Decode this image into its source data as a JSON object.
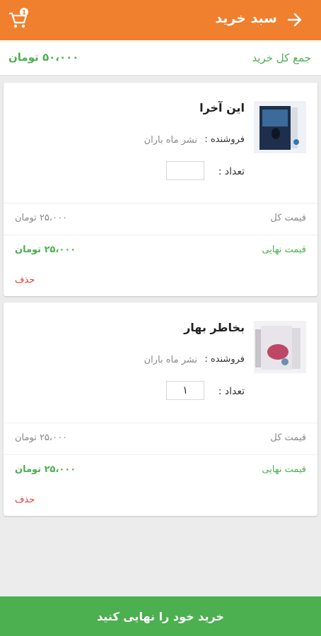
{
  "header": {
    "title": "سبد خرید",
    "back_icon": "arrow-right-icon",
    "cart_icon": "cart-icon",
    "cart_badge": "1",
    "bg_color": "#f07f2e"
  },
  "summary": {
    "label": "جمع کل خرید",
    "value": "۵۰،۰۰۰ تومان"
  },
  "items": [
    {
      "title": "این آخرا",
      "seller_label": "فروشنده :",
      "seller": "نشر ماه باران",
      "qty_label": "تعداد :",
      "qty": "",
      "total_label": "قیمت کل",
      "total": "۲۵،۰۰۰ تومان",
      "final_label": "قیمت نهایی",
      "final": "۲۵،۰۰۰ تومان",
      "delete_label": "حذف"
    },
    {
      "title": "بخاطر بهار",
      "seller_label": "فروشنده :",
      "seller": "نشر ماه باران",
      "qty_label": "تعداد :",
      "qty": "۱",
      "total_label": "قیمت کل",
      "total": "۲۵،۰۰۰ تومان",
      "final_label": "قیمت نهایی",
      "final": "۲۵،۰۰۰ تومان",
      "delete_label": "حذف"
    }
  ],
  "checkout": {
    "label": "خرید خود را نهایی کنید",
    "bg_color": "#4caf50"
  }
}
